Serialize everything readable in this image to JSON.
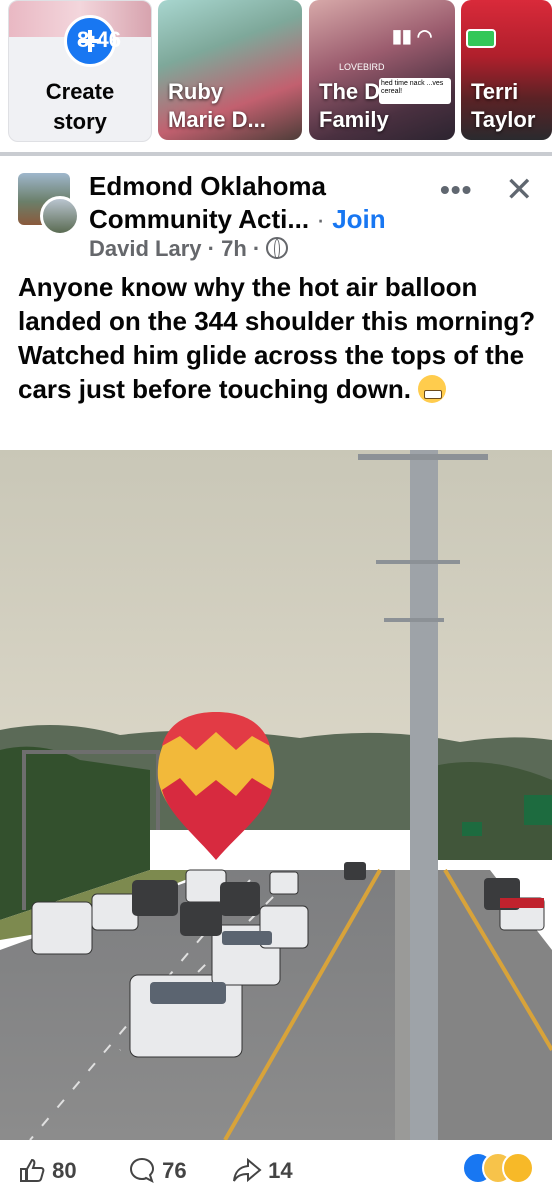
{
  "status_bar": {
    "time": "8:46"
  },
  "stories": {
    "create_label_1": "Create",
    "create_label_2": "story",
    "items": [
      {
        "name_1": "Ruby",
        "name_2": "Marie D..."
      },
      {
        "name_1": "The Deal",
        "name_2": "Family"
      },
      {
        "name_1": "Terri",
        "name_2": "Taylor"
      }
    ],
    "overlay_brand": "LOVEBIRD",
    "overlay_sticker": "hed time nack ...ves cereal!"
  },
  "post": {
    "group_name": "Edmond Oklahoma Community Acti...",
    "join_label": "Join",
    "author": "David Lary",
    "time": "7h",
    "caption": "Anyone know why the hot air balloon landed on the 344 shoulder this morning? Watched him glide across the tops of the cars just before touching down.",
    "emoji_name": "grimacing-face-emoji"
  },
  "actions": {
    "likes": "80",
    "comments": "76",
    "shares": "14"
  },
  "colors": {
    "brand": "#1877f2",
    "balloon_top": "#e23b45",
    "balloon_bottom": "#d72a3f",
    "balloon_band": "#f2b93a"
  }
}
